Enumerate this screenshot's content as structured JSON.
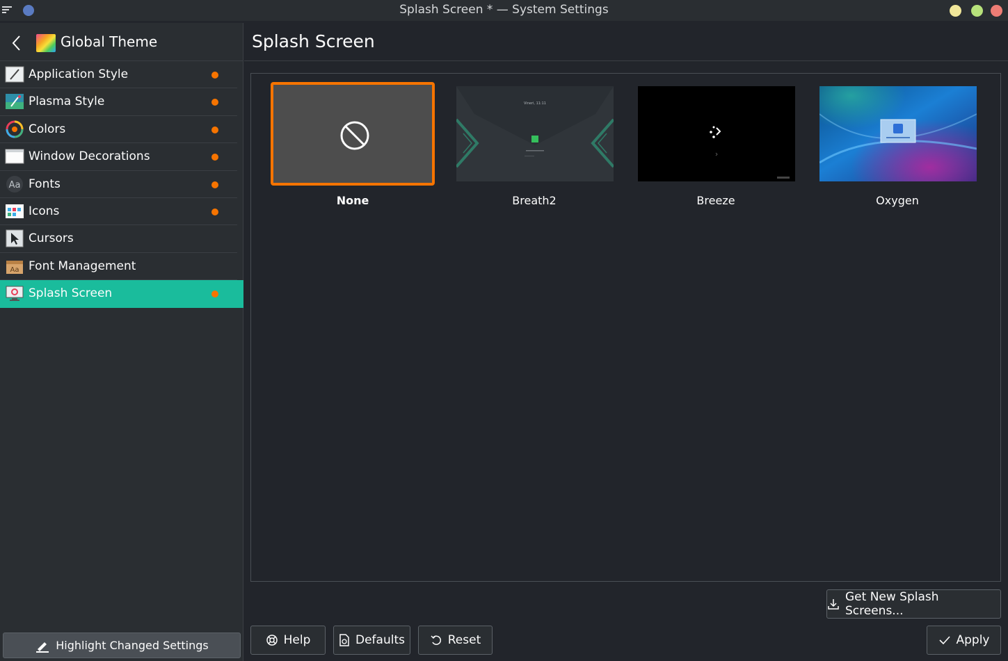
{
  "window": {
    "title": "Splash Screen * — System Settings"
  },
  "sidebar": {
    "header_title": "Global Theme",
    "items": [
      {
        "label": "Application Style",
        "icon": "application-style-icon",
        "changed": true
      },
      {
        "label": "Plasma Style",
        "icon": "plasma-style-icon",
        "changed": true
      },
      {
        "label": "Colors",
        "icon": "colors-icon",
        "changed": true
      },
      {
        "label": "Window Decorations",
        "icon": "window-decorations-icon",
        "changed": true
      },
      {
        "label": "Fonts",
        "icon": "fonts-icon",
        "changed": true
      },
      {
        "label": "Icons",
        "icon": "icons-icon",
        "changed": true
      },
      {
        "label": "Cursors",
        "icon": "cursors-icon",
        "changed": false
      },
      {
        "label": "Font Management",
        "icon": "font-management-icon",
        "changed": false
      },
      {
        "label": "Splash Screen",
        "icon": "splash-screen-icon",
        "changed": true,
        "active": true
      }
    ],
    "highlight_button": "Highlight Changed Settings"
  },
  "main": {
    "page_title": "Splash Screen",
    "themes": [
      {
        "name": "None",
        "selected": true
      },
      {
        "name": "Breath2",
        "selected": false,
        "preview_text": "Vineri, 11:11"
      },
      {
        "name": "Breeze",
        "selected": false
      },
      {
        "name": "Oxygen",
        "selected": false
      }
    ],
    "get_new_button": "Get New Splash Screens...",
    "help_button": "Help",
    "defaults_button": "Defaults",
    "reset_button": "Reset",
    "apply_button": "Apply"
  },
  "colors": {
    "accent": "#1abc9c",
    "changed_dot": "#f67400",
    "selection_border": "#f67400",
    "background": "#22252b"
  }
}
